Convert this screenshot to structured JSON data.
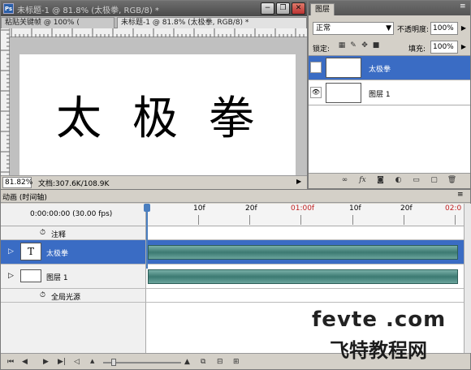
{
  "document_window": {
    "app_icon": "Ps",
    "title": "未标题-1 @ 81.8% (太极拳, RGB/8) *",
    "tabs": [
      {
        "label": "粘贴关键帧 @ 100% ("
      },
      {
        "label": "未标题-1 @ 81.8% (太极拳, RGB/8) *"
      }
    ],
    "canvas_text": "太极拳",
    "zoom": "81.82%",
    "doc_size": "文档:307.6K/108.9K",
    "window_buttons": {
      "minimize": "−",
      "maximize": "❐",
      "close": "✕"
    }
  },
  "layers_panel": {
    "tab": "图层",
    "menu": "≡",
    "blend_mode": "正常",
    "opacity_label": "不透明度:",
    "opacity": "100%",
    "lock_label": "锁定:",
    "fill_label": "填充:",
    "fill": "100%",
    "layers": [
      {
        "name": "太极拳",
        "thumb": "T",
        "selected": true
      },
      {
        "name": "图层 1",
        "thumb": "",
        "selected": false
      }
    ],
    "footer_icons": [
      "link-icon",
      "fx-icon",
      "mask-icon",
      "adjustment-icon",
      "group-icon",
      "new-layer-icon",
      "trash-icon"
    ]
  },
  "animation_panel": {
    "tab": "动画 (时间轴)",
    "menu": "≡",
    "timecode": "0:00:00:00",
    "fps": "(30.00 fps)",
    "ruler_labels": [
      "10f",
      "20f",
      "01:00f",
      "10f",
      "20f",
      "02:0"
    ],
    "tracks": [
      {
        "label": "注释",
        "type": "sub"
      },
      {
        "label": "太极拳",
        "type": "layer",
        "thumb": "T",
        "selected": true
      },
      {
        "label": "图层 1",
        "type": "layer",
        "thumb": "",
        "selected": false
      },
      {
        "label": "全局光源",
        "type": "sub"
      }
    ]
  },
  "watermark": {
    "line1": "fevte .com",
    "line2": "飞特教程网"
  }
}
